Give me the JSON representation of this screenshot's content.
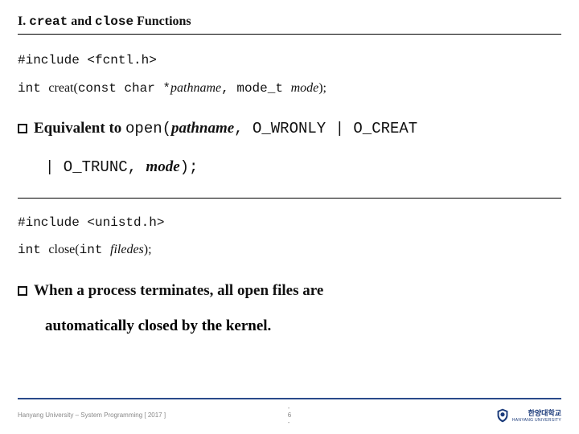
{
  "title": {
    "roman": "I. ",
    "mono1": "creat",
    "and": " and ",
    "mono2": "close",
    "rest": " Functions"
  },
  "include1": "#include <fcntl.h>",
  "proto1": {
    "p1": "int ",
    "fn": "creat(",
    "p2": "const char *",
    "arg1": "pathname",
    "p3": ", mode_t ",
    "arg2": "mode",
    "p4": ");"
  },
  "bullet1": {
    "lead": "Equivalent to ",
    "m1": "open(",
    "arg": "pathname",
    "m2": ", O_WRONLY | O_CREAT"
  },
  "bullet1_cont": {
    "m1": "| O_TRUNC, ",
    "arg": "mode",
    "m2": ");"
  },
  "include2": "#include <unistd.h>",
  "proto2": {
    "p1": "int ",
    "fn": "close(",
    "p2": "int ",
    "arg1": "filedes",
    "p3": ");"
  },
  "bullet2": "When a process terminates, all open files are",
  "bullet2_cont": "automatically closed by the kernel.",
  "footer": {
    "left": "Hanyang University – System Programming [ 2017 ]",
    "center": "- 6 -",
    "logo_kr": "한양대학교",
    "logo_en": "HANYANG UNIVERSITY"
  }
}
